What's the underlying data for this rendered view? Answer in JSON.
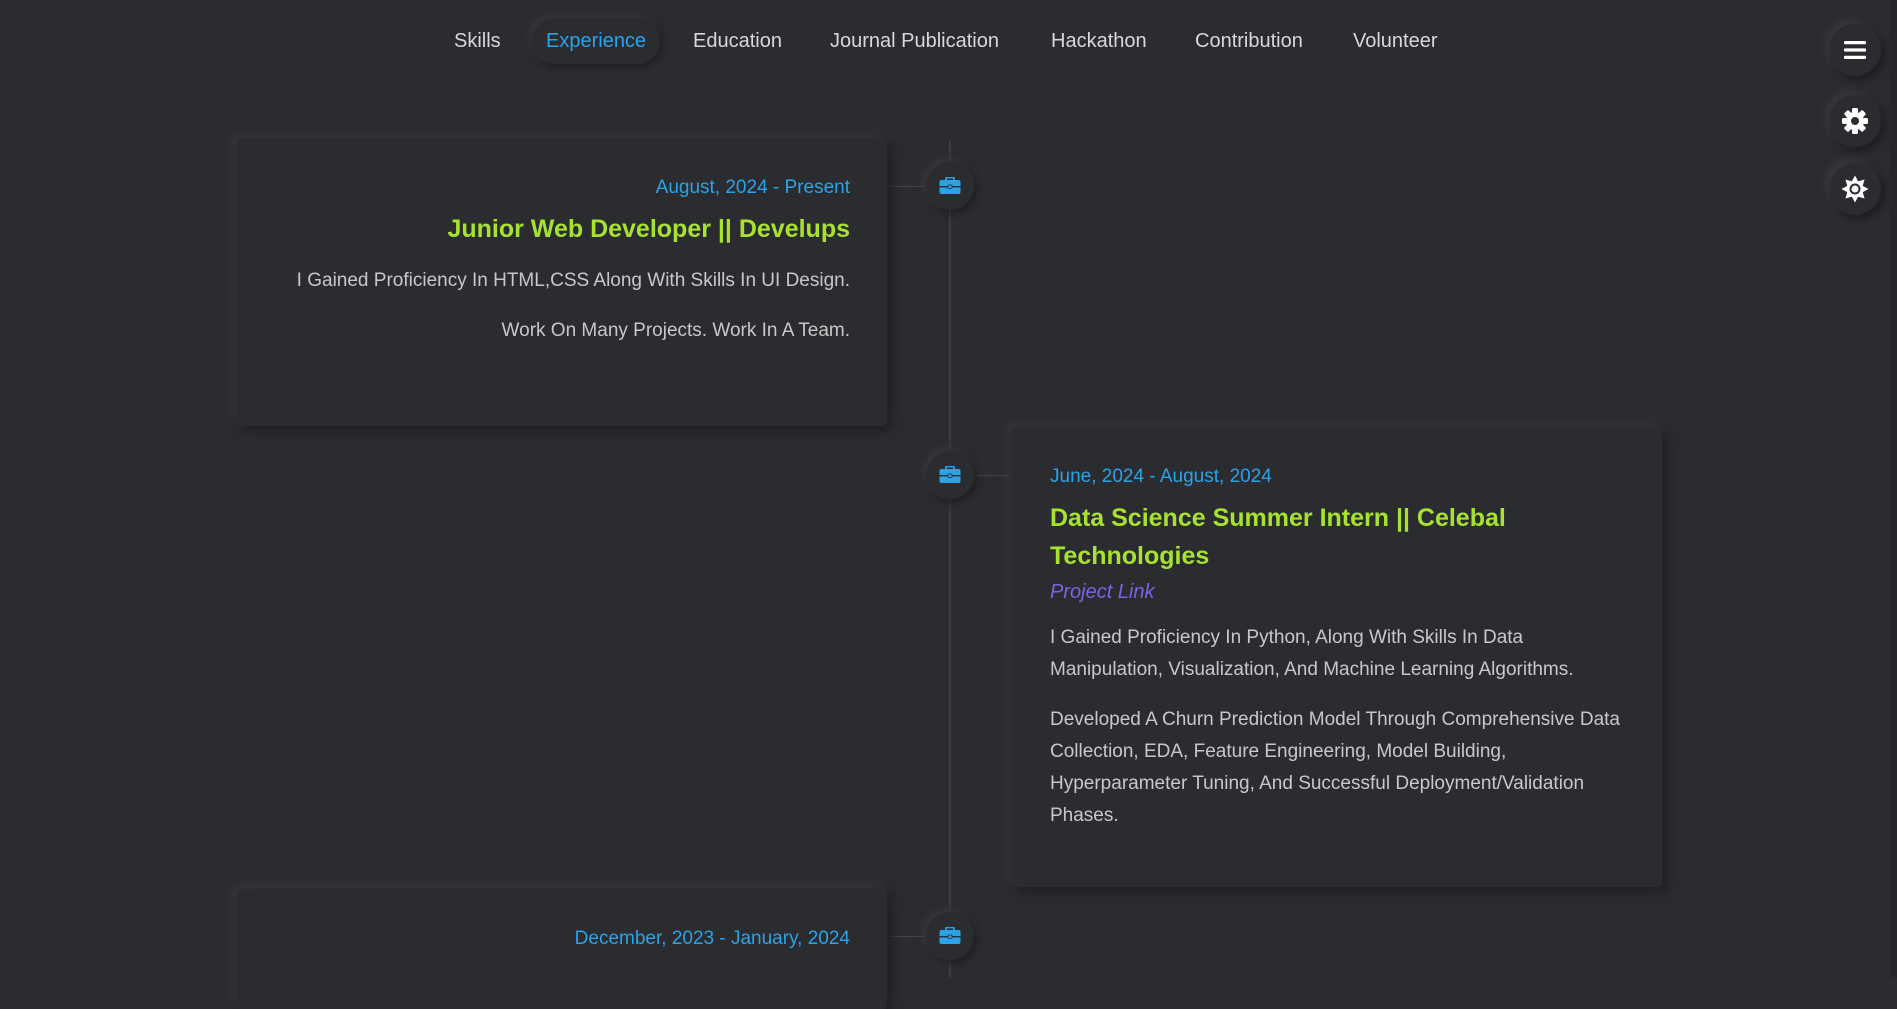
{
  "nav": {
    "tabs": [
      {
        "label": "Skills",
        "active": false
      },
      {
        "label": "Experience",
        "active": true
      },
      {
        "label": "Education",
        "active": false
      },
      {
        "label": "Journal Publication",
        "active": false
      },
      {
        "label": "Hackathon",
        "active": false
      },
      {
        "label": "Contribution",
        "active": false
      },
      {
        "label": "Volunteer",
        "active": false
      }
    ]
  },
  "floating_buttons": [
    {
      "icon": "hamburger-menu-icon"
    },
    {
      "icon": "gear-icon"
    },
    {
      "icon": "sun-brightness-icon"
    }
  ],
  "colors": {
    "background": "#2b2c30",
    "accent_blue": "#2aa3e8",
    "title_green": "#a6e22e",
    "link_purple": "#7d63e6",
    "body_text": "#c8c8c8"
  },
  "timeline_icon": "briefcase-icon",
  "experience": [
    {
      "side": "left",
      "date": "August, 2024 - Present",
      "title": "Junior Web Developer || Develups",
      "link": "",
      "paragraphs": [
        "I Gained Proficiency In HTML,CSS Along With Skills In UI Design.",
        "Work On Many Projects. Work In A Team."
      ]
    },
    {
      "side": "right",
      "date": "June, 2024 - August, 2024",
      "title": "Data Science Summer Intern || Celebal Technologies",
      "link": "Project Link",
      "paragraphs": [
        "I Gained Proficiency In Python, Along With Skills In Data Manipulation, Visualization, And Machine Learning Algorithms.",
        "Developed A Churn Prediction Model Through Comprehensive Data Collection, EDA, Feature Engineering, Model Building, Hyperparameter Tuning, And Successful Deployment/Validation Phases."
      ]
    },
    {
      "side": "left",
      "date": "December, 2023 - January, 2024",
      "title": "",
      "link": "",
      "paragraphs": []
    }
  ]
}
